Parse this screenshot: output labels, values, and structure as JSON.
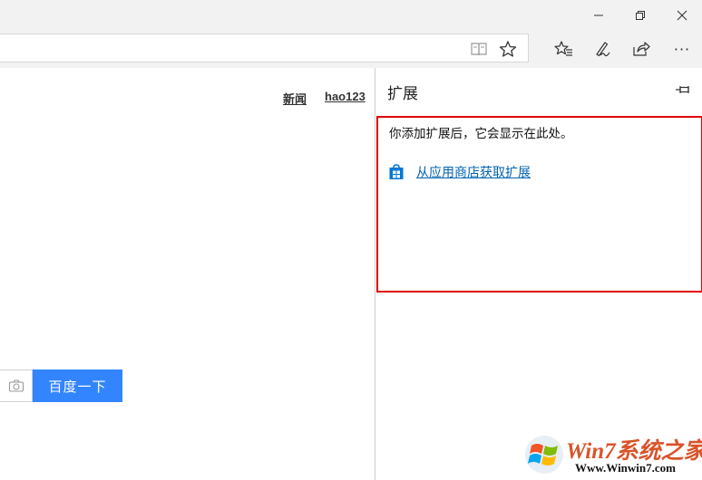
{
  "window": {
    "controls": {
      "minimize": "—",
      "restore": "⧉",
      "close": "✕"
    }
  },
  "toolbar": {
    "icons": [
      "reading-view-icon",
      "favorite-star-icon",
      "favorites-hub-icon",
      "web-note-pen-icon",
      "share-icon",
      "more-icon"
    ],
    "more_label": "···"
  },
  "page": {
    "links": {
      "news": "新闻",
      "hao123": "hao123"
    },
    "search_button": "百度一下"
  },
  "extensions_panel": {
    "title": "扩展",
    "empty_message": "你添加扩展后，它会显示在此处。",
    "store_link": "从应用商店获取扩展"
  },
  "watermark": {
    "brand": "Win7系统之家",
    "url": "Www.Winwin7.com"
  },
  "colors": {
    "search_button": "#3385ff",
    "link": "#0063b1",
    "highlight_border": "#e00000",
    "chrome": "#f2f2f2"
  }
}
